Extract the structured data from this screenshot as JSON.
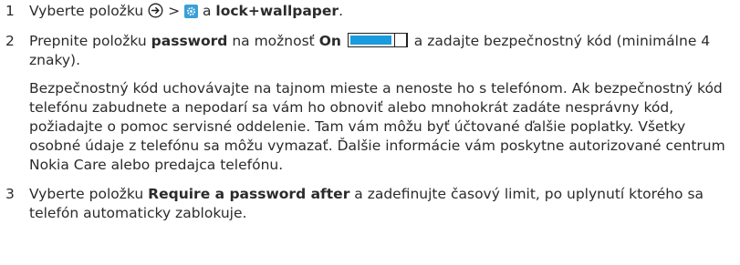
{
  "steps": [
    {
      "num": "1",
      "t1": "Vyberte položku",
      "sep": ">",
      "a": "a",
      "bold1": "lock+wallpaper",
      "end": "."
    },
    {
      "num": "2",
      "t1": "Prepnite položku",
      "bold1": "password",
      "t2": "na možnosť",
      "bold2": "On",
      "t3": "a zadajte bezpečnostný kód (minimálne 4 znaky).",
      "note": "Bezpečnostný kód uchovávajte na tajnom mieste a nenoste ho s telefónom. Ak bezpečnostný kód telefónu zabudnete a nepodarí sa vám ho obnoviť alebo mnohokrát zadáte nesprávny kód, požiadajte o pomoc servisné oddelenie. Tam vám môžu byť účtované ďalšie poplatky. Všetky osobné údaje z telefónu sa môžu vymazať. Ďalšie informácie vám poskytne autorizované centrum Nokia Care alebo predajca telefónu."
    },
    {
      "num": "3",
      "t1": "Vyberte položku",
      "bold1": "Require a password after",
      "t2": "a zadefinujte časový limit, po uplynutí ktorého sa telefón automaticky zablokuje."
    }
  ],
  "icons": {
    "arrow": "circle-arrow-right-icon",
    "settings": "settings-gear-icon",
    "toggle": "toggle-switch-on-icon"
  },
  "colors": {
    "text": "#2b2b2b",
    "accent": "#1a9be0",
    "settings_tile": "#3aa0d8"
  }
}
